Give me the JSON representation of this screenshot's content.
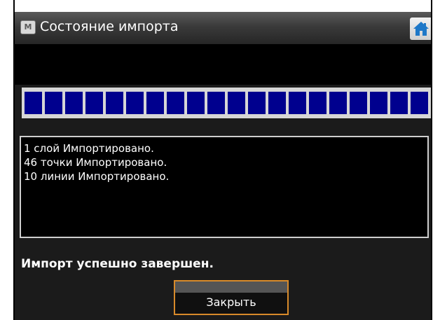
{
  "window": {
    "title": "Состояние импорта",
    "app_icon": "app-icon",
    "home_icon": "home-icon"
  },
  "progress": {
    "value": 1.0,
    "segment_count": 20,
    "fill_color": "#00008e"
  },
  "log": {
    "lines": [
      "1 слой Импортировано.",
      "46 точки Импортировано.",
      "10 линии Импортировано."
    ]
  },
  "status": {
    "message": "Импорт успешно завершен."
  },
  "buttons": {
    "close_label": "Закрыть"
  },
  "colors": {
    "button_border": "#d88a2a"
  }
}
